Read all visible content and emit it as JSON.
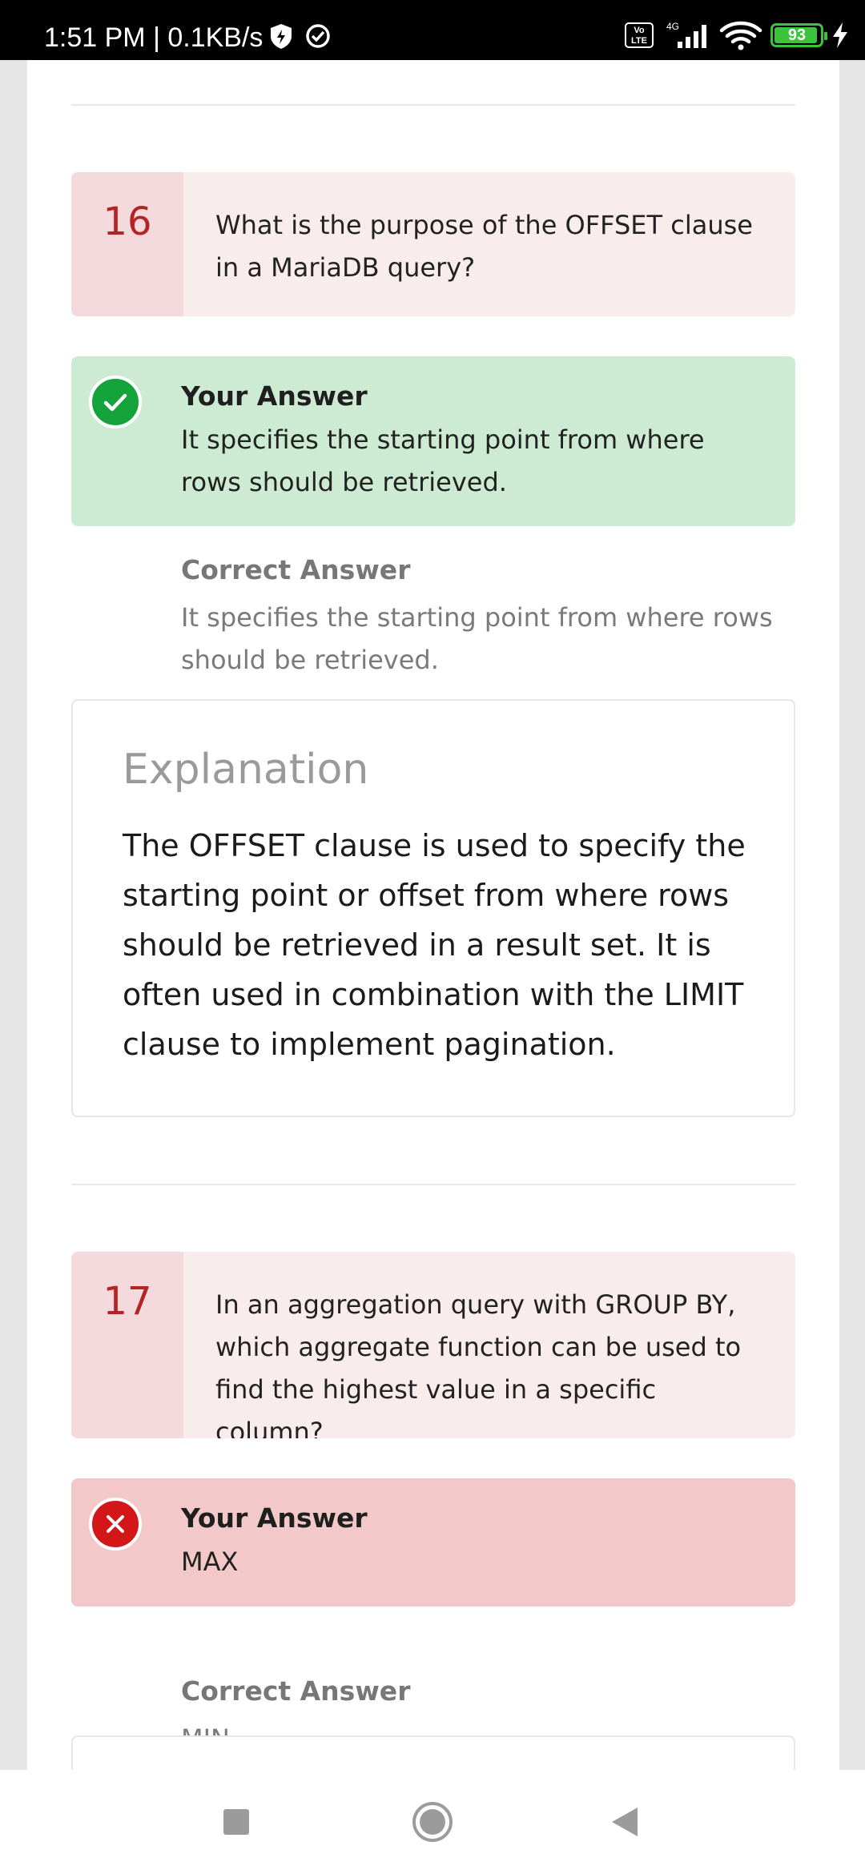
{
  "status_bar": {
    "time": "1:51 PM | 0.1KB/s",
    "volte_line1": "Vo",
    "volte_line2": "LTE",
    "network": "4G",
    "battery": "93"
  },
  "questions": [
    {
      "number": "16",
      "text": "What is the purpose of the OFFSET clause in a MariaDB query?",
      "your_answer_title": "Your Answer",
      "your_answer": "It specifies the starting point from where rows should be retrieved.",
      "result": "correct",
      "correct_answer_title": "Correct Answer",
      "correct_answer": "It specifies the starting point from where rows should be retrieved.",
      "explanation_title": "Explanation",
      "explanation": "The OFFSET clause is used to specify the starting point or offset from where rows should be retrieved in a result set. It is often used in combination with the LIMIT clause to implement pagination."
    },
    {
      "number": "17",
      "text": "In an aggregation query with GROUP BY, which aggregate function can be used to find the highest value in a specific column?",
      "your_answer_title": "Your Answer",
      "your_answer": "MAX",
      "result": "incorrect",
      "correct_answer_title": "Correct Answer",
      "correct_answer": "MIN"
    }
  ],
  "icons": {
    "correct": "check-icon",
    "incorrect": "x-icon",
    "nav_recents": "square-icon",
    "nav_home": "circle-icon",
    "nav_back": "triangle-back-icon"
  },
  "colors": {
    "correct_bg": "#cdebd2",
    "incorrect_bg": "#f3c8c9",
    "question_number": "#b32424"
  }
}
